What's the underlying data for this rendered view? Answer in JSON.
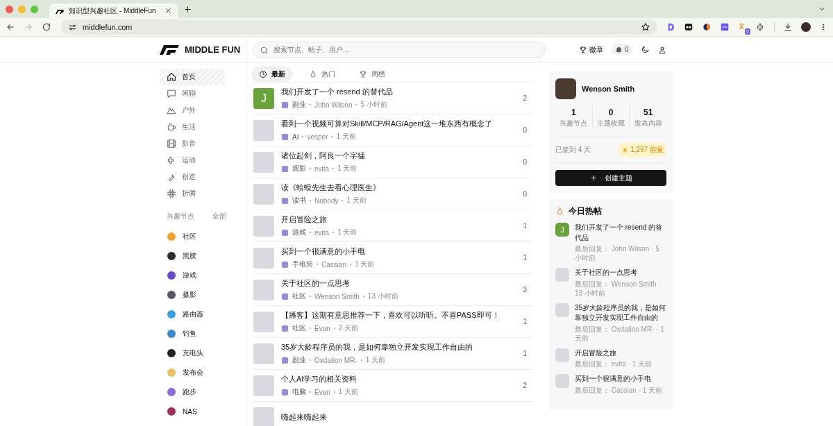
{
  "browser": {
    "tab_title": "知识型兴趣社区 - MiddleFun",
    "url": "middlefun.com",
    "extension_badge": "0"
  },
  "header": {
    "logo_text": "MIDDLE FUN",
    "search": {
      "placeholder": "搜索节点、帖子、用户..."
    },
    "badges_label": "徽章",
    "notifications": "0"
  },
  "sidebar": {
    "items": [
      {
        "label": "首页",
        "selected": true
      },
      {
        "label": "闲聊",
        "selected": false
      },
      {
        "label": "户外",
        "selected": false
      },
      {
        "label": "生活",
        "selected": false
      },
      {
        "label": "影音",
        "selected": false
      },
      {
        "label": "运动",
        "selected": false
      },
      {
        "label": "创造",
        "selected": false
      },
      {
        "label": "折腾",
        "selected": false
      }
    ],
    "nodes_title": "兴趣节点",
    "nodes_all": "全部",
    "nodes": [
      {
        "label": "社区",
        "color": "#f0a030"
      },
      {
        "label": "黑胶",
        "color": "#2a2a35"
      },
      {
        "label": "游戏",
        "color": "#6a4bd0"
      },
      {
        "label": "摄影",
        "color": "#555566"
      },
      {
        "label": "路由器",
        "color": "#3aa0e0"
      },
      {
        "label": "钓鱼",
        "color": "#3a8ad0"
      },
      {
        "label": "充电头",
        "color": "#222222"
      },
      {
        "label": "发布会",
        "color": "#e8c060"
      },
      {
        "label": "跑步",
        "color": "#8a6ad8"
      },
      {
        "label": "NAS",
        "color": "#a03060"
      }
    ]
  },
  "feed": {
    "tabs": [
      {
        "label": "最新",
        "selected": true
      },
      {
        "label": "热门",
        "selected": false
      },
      {
        "label": "周榜",
        "selected": false
      }
    ],
    "posts": [
      {
        "title": "我们开发了一个 resend 的替代品",
        "avatar": {
          "kind": "letter",
          "letter": "J",
          "color": "#6aa33c"
        },
        "node": "副业",
        "author": "John Wilson",
        "time": "5 小时前",
        "replies": "2"
      },
      {
        "title": "看到一个视频可算对Skill/MCP/RAG/Agent这一堆东西有概念了",
        "avatar": {
          "kind": "photo"
        },
        "node": "AI",
        "author": "vesper",
        "time": "1 天前",
        "replies": "0"
      },
      {
        "title": "诸位起剑，阿良一个字猛",
        "avatar": {
          "kind": "photo"
        },
        "node": "观影",
        "author": "evita",
        "time": "1 天前",
        "replies": "0"
      },
      {
        "title": "读《蛤蟆先生去看心理医生》",
        "avatar": {
          "kind": "photo"
        },
        "node": "读书",
        "author": "Nobody",
        "time": "1 天前",
        "replies": "0"
      },
      {
        "title": "开启冒险之旅",
        "avatar": {
          "kind": "photo"
        },
        "node": "游戏",
        "author": "evita",
        "time": "1 天前",
        "replies": "1"
      },
      {
        "title": "买到一个很满意的小手电",
        "avatar": {
          "kind": "photo"
        },
        "node": "手电筒",
        "author": "Cassian",
        "time": "1 天前",
        "replies": "1"
      },
      {
        "title": "关于社区的一点思考",
        "avatar": {
          "kind": "photo"
        },
        "node": "社区",
        "author": "Wenson Smith",
        "time": "13 小时前",
        "replies": "3"
      },
      {
        "title": "【播客】这期有意思推荐一下，喜欢可以听听。不喜PASS即可！",
        "avatar": {
          "kind": "photo"
        },
        "node": "社区",
        "author": "Evan",
        "time": "2 天前",
        "replies": "1"
      },
      {
        "title": "35岁大龄程序员的我，是如何靠独立开发实现工作自由的",
        "avatar": {
          "kind": "photo"
        },
        "node": "副业",
        "author": "Oxdation MR-",
        "time": "1 天前",
        "replies": "1"
      },
      {
        "title": "个人AI学习的相关资料",
        "avatar": {
          "kind": "photo"
        },
        "node": "电脑",
        "author": "Evan",
        "time": "1 天前",
        "replies": "2"
      },
      {
        "title": "嗨起来嗨起来",
        "avatar": {
          "kind": "photo"
        }
      }
    ]
  },
  "profile": {
    "name": "Wenson Smith",
    "stats": [
      {
        "value": "1",
        "label": "兴趣节点"
      },
      {
        "value": "0",
        "label": "主题收藏"
      },
      {
        "value": "51",
        "label": "发表内容"
      }
    ],
    "checkin": "已签到 4 天",
    "energy": "1,297 能量",
    "create_button": "创建主题"
  },
  "hot": {
    "title": "今日热帖",
    "posts": [
      {
        "title": "我们开发了一个 resend 的替代品",
        "avatar": {
          "kind": "letter",
          "letter": "J",
          "color": "#6aa33c"
        },
        "meta": "最后回复： John Wilson · 5 小时前"
      },
      {
        "title": "关于社区的一点思考",
        "avatar": {
          "kind": "photo"
        },
        "meta": "最后回复： Wenson Smith · 13 小时前"
      },
      {
        "title": "35岁大龄程序员的我，是如何靠独立开发实现工作自由的",
        "avatar": {
          "kind": "photo"
        },
        "meta": "最后回复： Oxdation MR- · 1 天前"
      },
      {
        "title": "开启冒险之旅",
        "avatar": {
          "kind": "photo"
        },
        "meta": "最后回复： evita · 1 天前"
      },
      {
        "title": "买到一个很满意的小手电",
        "avatar": {
          "kind": "photo"
        },
        "meta": "最后回复： Cassian · 1 天前"
      }
    ]
  }
}
